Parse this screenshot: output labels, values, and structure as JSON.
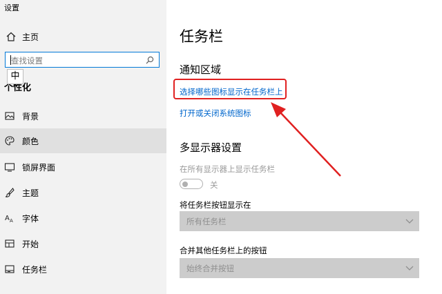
{
  "window": {
    "title": "设置"
  },
  "sidebar": {
    "home_label": "主页",
    "search_placeholder": "查找设置",
    "ime_label": "中",
    "section_label": "个性化",
    "items": [
      {
        "label": "背景",
        "icon": "image-icon"
      },
      {
        "label": "颜色",
        "icon": "palette-icon",
        "active": true
      },
      {
        "label": "锁屏界面",
        "icon": "lock-screen-icon"
      },
      {
        "label": "主题",
        "icon": "brush-icon"
      },
      {
        "label": "字体",
        "icon": "font-icon"
      },
      {
        "label": "开始",
        "icon": "start-icon"
      },
      {
        "label": "任务栏",
        "icon": "taskbar-icon"
      }
    ]
  },
  "main": {
    "title": "任务栏",
    "notification_area": {
      "heading": "通知区域",
      "link1": "选择哪些图标显示在任务栏上",
      "link2": "打开或关闭系统图标"
    },
    "multi_display": {
      "heading": "多显示器设置",
      "show_on_all_label": "在所有显示器上显示任务栏",
      "toggle_state_label": "关",
      "buttons_label": "将任务栏按钮显示在",
      "buttons_value": "所有任务栏",
      "combine_label": "合并其他任务栏上的按钮",
      "combine_value": "始终合并按钮"
    }
  },
  "colors": {
    "link": "#0066cc",
    "annotation": "#e02020",
    "active_item_bg": "#e0e0e0"
  }
}
